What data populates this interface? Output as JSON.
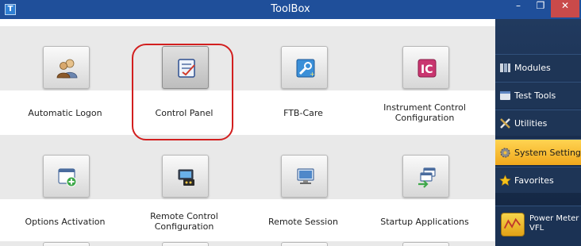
{
  "window": {
    "title": "ToolBox",
    "app_icon": "T",
    "minimize": "–",
    "maximize": "❐",
    "close": "✕"
  },
  "tiles": [
    {
      "label": "Automatic Logon",
      "icon": "users-icon"
    },
    {
      "label": "Control Panel",
      "icon": "control-panel-icon",
      "highlighted": true
    },
    {
      "label": "FTB-Care",
      "icon": "ftb-care-icon"
    },
    {
      "label": "Instrument Control Configuration",
      "icon": "instrument-control-icon"
    },
    {
      "label": "Options Activation",
      "icon": "options-activation-icon"
    },
    {
      "label": "Remote Control Configuration",
      "icon": "remote-control-icon"
    },
    {
      "label": "Remote Session",
      "icon": "remote-session-icon"
    },
    {
      "label": "Startup Applications",
      "icon": "startup-applications-icon"
    }
  ],
  "sidebar": {
    "items": [
      {
        "label": "Modules",
        "icon": "modules-icon"
      },
      {
        "label": "Test Tools",
        "icon": "test-tools-icon"
      },
      {
        "label": "Utilities",
        "icon": "utilities-icon"
      },
      {
        "label": "System Settings",
        "icon": "gear-icon",
        "selected": true
      },
      {
        "label": "Favorites",
        "icon": "star-icon"
      }
    ],
    "power_meter": {
      "label_line1": "Power Meter -",
      "label_line2": "VFL",
      "icon": "power-meter-icon"
    }
  },
  "colors": {
    "titlebar": "#1f4f9a",
    "selected": "#f0a81c",
    "highlight": "#d21f1f"
  }
}
